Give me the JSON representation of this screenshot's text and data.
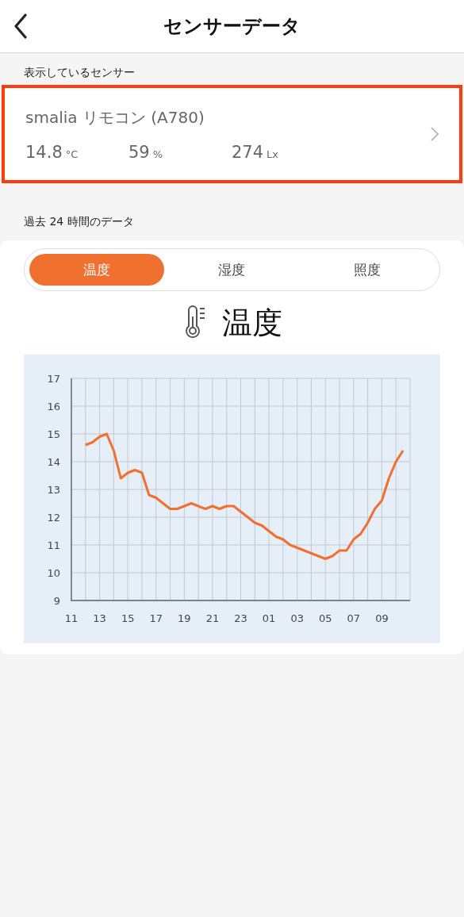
{
  "header": {
    "title": "センサーデータ"
  },
  "sensor_section": {
    "label": "表示しているセンサー",
    "highlighted": true
  },
  "sensor": {
    "name": "smalia リモコン (A780)",
    "readings": [
      {
        "value": "14.8",
        "unit": "°C"
      },
      {
        "value": "59",
        "unit": "%"
      },
      {
        "value": "274",
        "unit": "Lx"
      }
    ]
  },
  "history": {
    "label": "過去 24 時間のデータ"
  },
  "tabs": [
    {
      "label": "温度",
      "selected": true
    },
    {
      "label": "湿度",
      "selected": false
    },
    {
      "label": "照度",
      "selected": false
    }
  ],
  "chart_title": "温度",
  "chart_data": {
    "type": "line",
    "categories": [
      "11",
      null,
      null,
      null,
      "13",
      null,
      null,
      null,
      "15",
      null,
      null,
      null,
      "17",
      null,
      null,
      null,
      "19",
      null,
      null,
      null,
      "21",
      null,
      null,
      null,
      "23",
      null,
      null,
      null,
      "01",
      null,
      null,
      null,
      "03",
      null,
      null,
      null,
      "05",
      null,
      null,
      null,
      "07",
      null,
      null,
      null,
      "09",
      null,
      null,
      null
    ],
    "series": [
      {
        "color": "#f07030",
        "values": [
          null,
          null,
          14.6,
          14.7,
          14.9,
          15.0,
          14.4,
          13.4,
          13.6,
          13.7,
          13.6,
          12.8,
          12.7,
          12.5,
          12.3,
          12.3,
          12.4,
          12.5,
          12.4,
          12.3,
          12.4,
          12.3,
          12.4,
          12.4,
          12.2,
          12.0,
          11.8,
          11.7,
          11.5,
          11.3,
          11.2,
          11.0,
          10.9,
          10.8,
          10.7,
          10.6,
          10.5,
          10.6,
          10.8,
          10.8,
          11.2,
          11.4,
          11.8,
          12.3,
          12.6,
          13.4,
          14.0,
          14.4
        ]
      }
    ],
    "grid": true,
    "ylim": [
      9,
      17
    ],
    "yticks": [
      9,
      10,
      11,
      12,
      13,
      14,
      15,
      16,
      17
    ]
  }
}
